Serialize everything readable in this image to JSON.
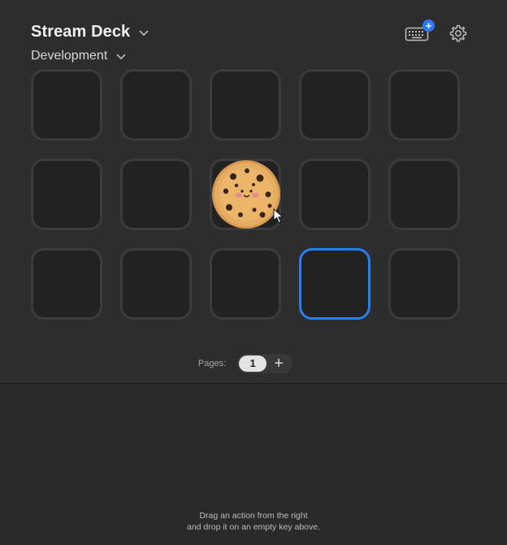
{
  "header": {
    "device_name": "Stream Deck",
    "profile_name": "Development",
    "keyboard_badge": "+"
  },
  "grid": {
    "rows": 3,
    "columns": 5,
    "selected_key": "row 3, column 4",
    "cookie_key": "row 2, column 3"
  },
  "pages": {
    "label": "Pages:",
    "current": "1",
    "add": "+"
  },
  "hint": {
    "line1": "Drag an action from the right",
    "line2": "and drop it on an empty key above."
  },
  "colors": {
    "accent": "#2a7ff0",
    "key_border": "#3b3b3b",
    "key_fill": "#222222"
  },
  "icons": [
    "chevron-down-icon",
    "keyboard-icon",
    "gear-icon",
    "cookie-icon",
    "mouse-cursor-icon"
  ]
}
